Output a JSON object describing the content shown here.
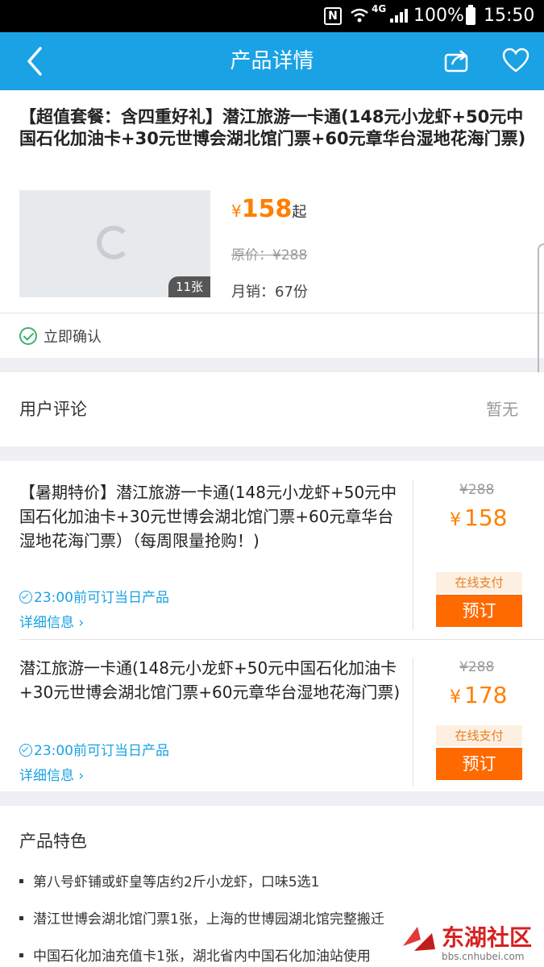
{
  "status_bar": {
    "nfc": "N",
    "network_type": "4G",
    "battery_percent": "100%",
    "time": "15:50"
  },
  "nav": {
    "title": "产品详情",
    "icons": [
      "back-arrow-icon",
      "share-icon",
      "heart-icon"
    ]
  },
  "product": {
    "title": "【超值套餐：含四重好礼】潜江旅游一卡通(148元小龙虾+50元中国石化加油卡+30元世博会湖北馆门票+60元章华台湿地花海门票)",
    "photo_count": "11张",
    "price_symbol": "¥",
    "price": "158",
    "price_suffix": "起",
    "original_price": "原价：¥288",
    "monthly_sales": "月销：67份",
    "confirm_label": "立即确认"
  },
  "reviews": {
    "label": "用户评论",
    "value": "暂无"
  },
  "packages": [
    {
      "title": "【暑期特价】潜江旅游一卡通(148元小龙虾+50元中国石化加油卡+30元世博会湖北馆门票+60元章华台湿地花海门票）（每周限量抢购！)",
      "note": "23:00前可订当日产品",
      "detail_link": "详细信息",
      "original_price": "¥288",
      "price_symbol": "¥",
      "price": "158",
      "pay_tag": "在线支付",
      "book_label": "预订"
    },
    {
      "title": "潜江旅游一卡通(148元小龙虾+50元中国石化加油卡+30元世博会湖北馆门票+60元章华台湿地花海门票)",
      "note": "23:00前可订当日产品",
      "detail_link": "详细信息",
      "original_price": "¥288",
      "price_symbol": "¥",
      "price": "178",
      "pay_tag": "在线支付",
      "book_label": "预订"
    }
  ],
  "features": {
    "title": "产品特色",
    "items": [
      "第八号虾铺或虾皇等店约2斤小龙虾，口味5选1",
      "潜江世博会湖北馆门票1张，上海的世博园湖北馆完整搬迁",
      "中国石化加油充值卡1张，湖北省内中国石化加油站使用"
    ]
  },
  "watermark": {
    "name": "东湖社区",
    "url": "bbs.cnhubei.com"
  },
  "colors": {
    "nav_blue": "#1aa2e4",
    "price_orange": "#ff7f00",
    "book_button": "#ff6a00",
    "confirm_green": "#3cb371"
  }
}
